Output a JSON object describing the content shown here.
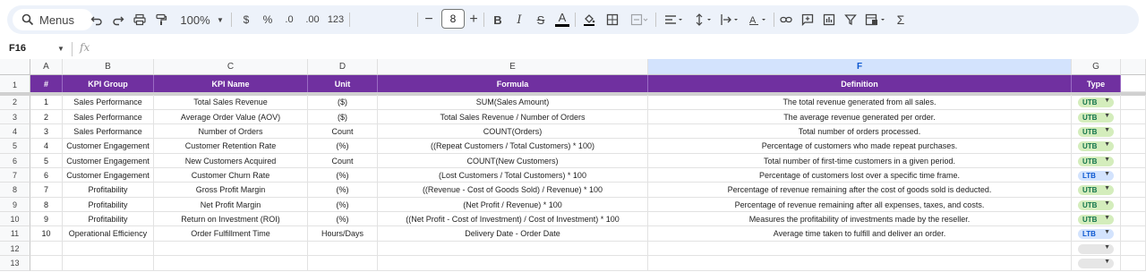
{
  "toolbar": {
    "menus_label": "Menus",
    "zoom": "100%",
    "currency": "$",
    "percent": "%",
    "dec_decrease": ".0",
    "dec_increase": ".00",
    "number_format": "123",
    "font_size": "8"
  },
  "formula_bar": {
    "cell_ref": "F16",
    "fx": "fx",
    "value": ""
  },
  "columns": [
    "A",
    "B",
    "C",
    "D",
    "E",
    "F",
    "G"
  ],
  "selected_column": "F",
  "row_numbers": [
    "1",
    "2",
    "3",
    "4",
    "5",
    "6",
    "7",
    "8",
    "9",
    "10",
    "11",
    "12",
    "13"
  ],
  "header": [
    "#",
    "KPI Group",
    "KPI Name",
    "Unit",
    "Formula",
    "Definition",
    "Type"
  ],
  "rows": [
    {
      "num": "1",
      "group": "Sales Performance",
      "name": "Total Sales Revenue",
      "unit": "($)",
      "formula": "SUM(Sales Amount)",
      "definition": "The total revenue generated from all sales.",
      "type": "UTB"
    },
    {
      "num": "2",
      "group": "Sales Performance",
      "name": "Average Order Value (AOV)",
      "unit": "($)",
      "formula": "Total Sales Revenue / Number of Orders",
      "definition": "The average revenue generated per order.",
      "type": "UTB"
    },
    {
      "num": "3",
      "group": "Sales Performance",
      "name": "Number of Orders",
      "unit": "Count",
      "formula": "COUNT(Orders)",
      "definition": "Total number of orders processed.",
      "type": "UTB"
    },
    {
      "num": "4",
      "group": "Customer Engagement",
      "name": "Customer Retention Rate",
      "unit": "(%)",
      "formula": "((Repeat Customers / Total Customers) * 100)",
      "definition": "Percentage of customers who made repeat purchases.",
      "type": "UTB"
    },
    {
      "num": "5",
      "group": "Customer Engagement",
      "name": "New Customers Acquired",
      "unit": "Count",
      "formula": "COUNT(New Customers)",
      "definition": "Total number of first-time customers in a given period.",
      "type": "UTB"
    },
    {
      "num": "6",
      "group": "Customer Engagement",
      "name": "Customer Churn Rate",
      "unit": "(%)",
      "formula": "(Lost Customers / Total Customers) * 100",
      "definition": "Percentage of customers lost over a specific time frame.",
      "type": "LTB"
    },
    {
      "num": "7",
      "group": "Profitability",
      "name": "Gross Profit Margin",
      "unit": "(%)",
      "formula": "((Revenue - Cost of Goods Sold) / Revenue) * 100",
      "definition": "Percentage of revenue remaining after the cost of goods sold is deducted.",
      "type": "UTB"
    },
    {
      "num": "8",
      "group": "Profitability",
      "name": "Net Profit Margin",
      "unit": "(%)",
      "formula": "(Net Profit / Revenue) * 100",
      "definition": "Percentage of revenue remaining after all expenses, taxes, and costs.",
      "type": "UTB"
    },
    {
      "num": "9",
      "group": "Profitability",
      "name": "Return on Investment (ROI)",
      "unit": "(%)",
      "formula": "((Net Profit - Cost of Investment) / Cost of Investment) * 100",
      "definition": "Measures the profitability of investments made by the reseller.",
      "type": "UTB"
    },
    {
      "num": "10",
      "group": "Operational Efficiency",
      "name": "Order Fulfillment Time",
      "unit": "Hours/Days",
      "formula": "Delivery Date - Order Date",
      "definition": "Average time taken to fulfill and deliver an order.",
      "type": "LTB"
    },
    {
      "num": "",
      "group": "",
      "name": "",
      "unit": "",
      "formula": "",
      "definition": "",
      "type": ""
    },
    {
      "num": "",
      "group": "",
      "name": "",
      "unit": "",
      "formula": "",
      "definition": "",
      "type": ""
    }
  ],
  "colors": {
    "header_bg": "#7030a0",
    "utb_chip": "#d4edbc",
    "ltb_chip": "#d3e3fd",
    "selected_col": "#d3e3fd"
  }
}
